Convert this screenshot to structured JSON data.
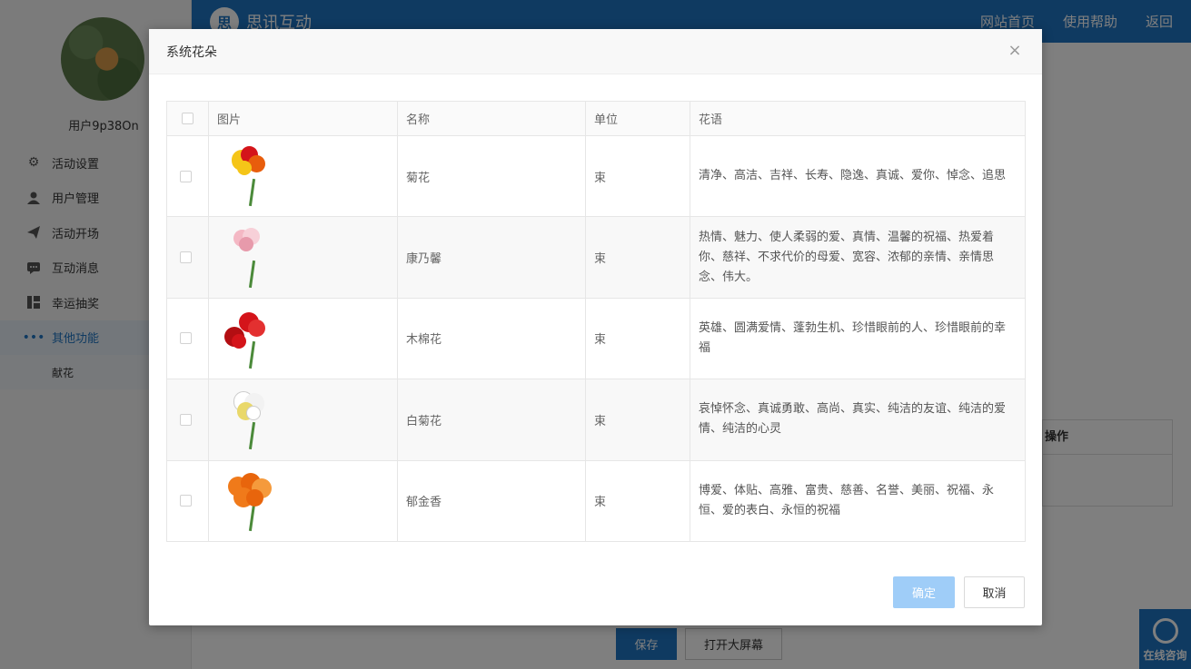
{
  "app": {
    "logo_icon": "思",
    "logo_text": "思讯互动",
    "nav": [
      "网站首页",
      "使用帮助",
      "返回"
    ]
  },
  "user": {
    "name": "用户9p38On"
  },
  "sidebar": {
    "items": [
      {
        "icon": "gear-icon",
        "label": "活动设置"
      },
      {
        "icon": "user-icon",
        "label": "用户管理"
      },
      {
        "icon": "paper-plane-icon",
        "label": "活动开场"
      },
      {
        "icon": "chat-icon",
        "label": "互动消息"
      },
      {
        "icon": "lottery-icon",
        "label": "幸运抽奖"
      },
      {
        "icon": "ellipsis-icon",
        "label": "其他功能"
      }
    ],
    "subitem": "献花"
  },
  "background": {
    "panel_header": "操作",
    "save_label": "保存",
    "open_screen_label": "打开大屏幕"
  },
  "consult": {
    "label": "在线咨询"
  },
  "modal": {
    "title": "系统花朵",
    "close_icon": "×",
    "columns": [
      "图片",
      "名称",
      "单位",
      "花语"
    ],
    "rows": [
      {
        "name": "菊花",
        "unit": "束",
        "desc": "清净、高洁、吉祥、长寿、隐逸、真诚、爱你、悼念、追思",
        "colors": [
          "#f5c518",
          "#d4141a",
          "#e85d0c"
        ]
      },
      {
        "name": "康乃馨",
        "unit": "束",
        "desc": "热情、魅力、使人柔弱的爱、真情、温馨的祝福、热爱着你、慈祥、不求代价的母爱、宽容、浓郁的亲情、亲情思念、伟大。",
        "colors": [
          "#f4b8c4",
          "#f7d0d8",
          "#e79aab"
        ]
      },
      {
        "name": "木棉花",
        "unit": "束",
        "desc": "英雄、圆满爱情、蓬勃生机、珍惜眼前的人、珍惜眼前的幸福",
        "colors": [
          "#d4141a",
          "#b30e12",
          "#e33030"
        ]
      },
      {
        "name": "白菊花",
        "unit": "束",
        "desc": "哀悼怀念、真诚勇敢、高尚、真实、纯洁的友谊、纯洁的爱情、纯洁的心灵",
        "colors": [
          "#ffffff",
          "#f2f2f2",
          "#e9d86a"
        ]
      },
      {
        "name": "郁金香",
        "unit": "束",
        "desc": "博爱、体贴、高雅、富贵、慈善、名誉、美丽、祝福、永恒、爱的表白、永恒的祝福",
        "colors": [
          "#f07a1a",
          "#e8650c",
          "#f59a3c"
        ]
      }
    ],
    "ok_label": "确定",
    "cancel_label": "取消"
  }
}
